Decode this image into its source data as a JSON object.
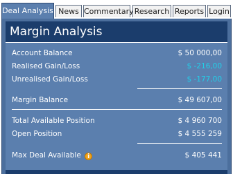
{
  "tabs": [
    {
      "label": "Deal Analysis",
      "active": true
    },
    {
      "label": "News",
      "active": false
    },
    {
      "label": "Commentary",
      "active": false
    },
    {
      "label": "Research",
      "active": false
    },
    {
      "label": "Reports",
      "active": false
    },
    {
      "label": "Login",
      "active": false
    }
  ],
  "panel": {
    "title": "Margin Analysis",
    "rows": {
      "account_balance": {
        "label": "Account Balance",
        "value": "$ 50 000,00"
      },
      "realised": {
        "label": "Realised Gain/Loss",
        "value": "$ -216,00"
      },
      "unrealised": {
        "label": "Unrealised Gain/Loss",
        "value": "$ -177,00"
      },
      "margin_balance": {
        "label": "Margin Balance",
        "value": "$ 49 607,00"
      },
      "total_available": {
        "label": "Total Available Position",
        "value": "$ 4 960 700"
      },
      "open_position": {
        "label": "Open Position",
        "value": "$ 4 555 259"
      },
      "max_deal": {
        "label": "Max Deal Available",
        "value": "$ 405 441"
      }
    }
  },
  "colors": {
    "accent": "#5b7fae",
    "header": "#1b3d6c",
    "negative": "#22cfe8",
    "info_icon": "#f0a21a"
  },
  "icons": {
    "info": "info-icon"
  }
}
